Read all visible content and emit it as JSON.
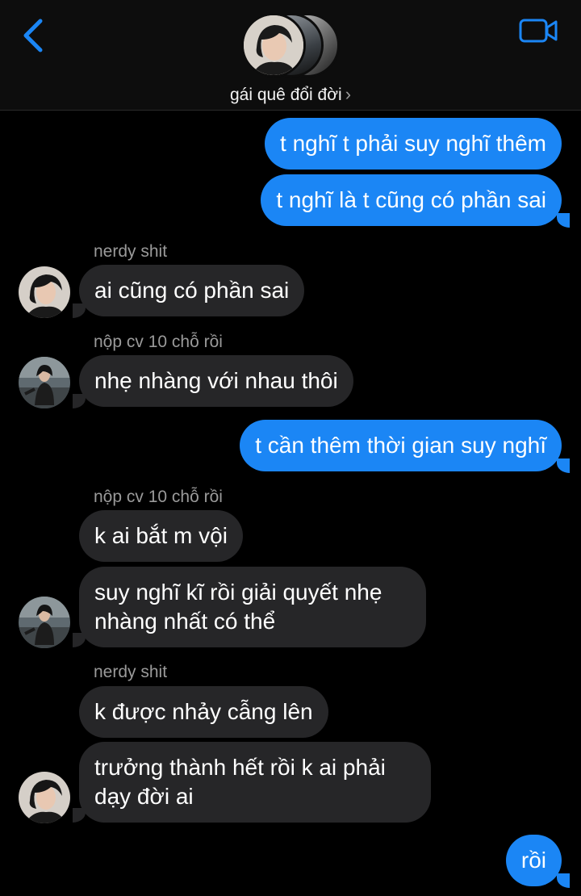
{
  "header": {
    "back_icon": "chevron-left-icon",
    "video_icon": "video-camera-icon",
    "group_name": "gái quê đổi đời",
    "group_chevron": "›",
    "accent": "#1b86f5"
  },
  "messages": [
    {
      "type": "out",
      "text": "t nghĩ t phải suy nghĩ thêm"
    },
    {
      "type": "out",
      "text": "t nghĩ là t cũng có phần sai"
    },
    {
      "type": "sender",
      "text": "nerdy shit"
    },
    {
      "type": "in",
      "text": "ai cũng có phần sai"
    },
    {
      "type": "sender",
      "text": "nộp cv 10 chỗ rồi"
    },
    {
      "type": "in",
      "text": "nhẹ nhàng với nhau thôi"
    },
    {
      "type": "out",
      "text": "t cần thêm thời gian suy nghĩ"
    },
    {
      "type": "sender",
      "text": "nộp cv 10 chỗ rồi"
    },
    {
      "type": "in",
      "text": "k ai bắt m vội"
    },
    {
      "type": "in",
      "line1": "suy nghĩ kĩ rồi giải quyết nhẹ",
      "line2": "nhàng nhất có thể"
    },
    {
      "type": "sender",
      "text": "nerdy shit"
    },
    {
      "type": "in",
      "text": "k được nhảy cẫng lên"
    },
    {
      "type": "in",
      "line1": "trưởng thành hết rồi k ai phải",
      "line2": "dạy đời ai"
    },
    {
      "type": "out",
      "text": "rồi"
    }
  ],
  "colors": {
    "outgoing": "#1b86f5",
    "incoming": "#262628",
    "background": "#000000"
  }
}
